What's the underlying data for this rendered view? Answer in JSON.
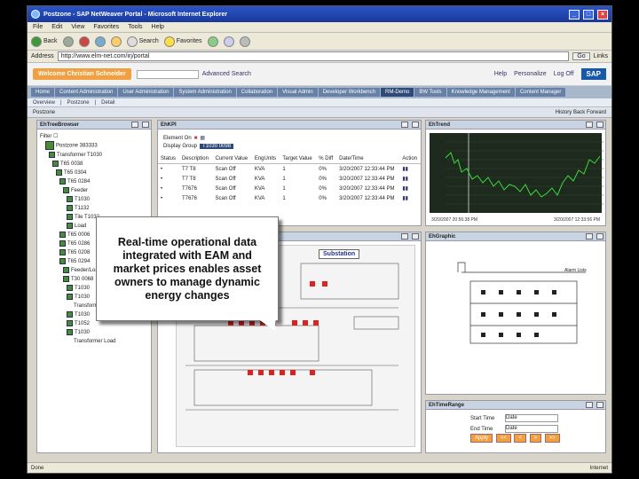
{
  "window": {
    "title": "Postzone - SAP NetWeaver Portal - Microsoft Internet Explorer"
  },
  "menu": [
    "File",
    "Edit",
    "View",
    "Favorites",
    "Tools",
    "Help"
  ],
  "toolbar": {
    "back": "Back",
    "search": "Search",
    "favorites": "Favorites"
  },
  "address": {
    "label": "Address",
    "value": "http://www.elm-net.com/irj/portal",
    "go": "Go",
    "links": "Links"
  },
  "portal": {
    "welcome": "Welcome Christian Schneider",
    "search_label": "Advanced Search",
    "links": [
      "Help",
      "Personalize",
      "Log Off"
    ],
    "logo": "SAP"
  },
  "tabs": [
    "Home",
    "Content Administration",
    "User Administration",
    "System Administration",
    "Collaboration",
    "Visual Admin",
    "Developer Workbench",
    "RM-Demo",
    "BW Tools",
    "Knowledge Management",
    "Content Manager"
  ],
  "subtabs": [
    "Overview",
    "Postzone",
    "Detail"
  ],
  "pagebar": {
    "title": "Postzone",
    "history": "History",
    "back": "Back",
    "forward": "Forward"
  },
  "panels": {
    "tree_title": "EhTreeBrowser",
    "table_title": "EhKPI",
    "trend_title": "EhTrend",
    "graphic_title": "EhGraphic",
    "range_title": "EhTimeRange"
  },
  "tree": {
    "filter": "Filter",
    "root": "Postzone 383333",
    "items": [
      "Transformer T1030",
      "T65 0038",
      "T65 0304",
      "T65 0284",
      "Feeder",
      "T1030",
      "T1132",
      "Tile T1032",
      "Load",
      "T65 0006",
      "T65 0286",
      "T65 0208",
      "T65 0294",
      "Feeder/Load",
      "T30 0068",
      "T1030",
      "T1030",
      "Transformer Load",
      "T1030",
      "T1052",
      "T1030",
      "Transformer Load"
    ]
  },
  "kpi": {
    "element_label": "Element On",
    "display_group_label": "Display Group",
    "display_group_value": "T1030 0098",
    "columns": [
      "Status",
      "Description",
      "Current Value",
      "EngUnits",
      "Target Value",
      "% Diff",
      "Date/Time",
      "Action"
    ],
    "rows": [
      [
        "•",
        "T7 T8",
        "Scan Off",
        "KVA",
        "1",
        "0%",
        "3/20/2007 12:33:44 PM",
        ""
      ],
      [
        "•",
        "T7 T8",
        "Scan Off",
        "KVA",
        "1",
        "0%",
        "3/20/2007 12:33:44 PM",
        ""
      ],
      [
        "•",
        "T7676",
        "Scan Off",
        "KVA",
        "1",
        "0%",
        "3/20/2007 12:33:44 PM",
        ""
      ],
      [
        "•",
        "T7676",
        "Scan Off",
        "KVA",
        "1",
        "0%",
        "3/20/2007 12:33:44 PM",
        ""
      ]
    ]
  },
  "trend": {
    "y_ticks": [
      "200",
      "190",
      "180",
      "170",
      "160",
      "150",
      "140",
      "130",
      "120",
      "110"
    ],
    "x_ticks": [
      "20",
      "18",
      "15",
      "15",
      "14 24 Hour(s)",
      "8",
      "6",
      "4",
      "2"
    ],
    "start": "3/20/2007 20:56:38 PM",
    "end": "3/20/2007 12:33:56 PM"
  },
  "schematic": {
    "label": "Substation"
  },
  "graphic_right": {
    "label": "Alarm Lists"
  },
  "range": {
    "start_label": "Start Time",
    "end_label": "End Time",
    "start_value": "Date",
    "end_value": "Date",
    "apply": "Apply",
    "prev": "<<",
    "back": "<",
    "fwd": ">",
    "next": ">>"
  },
  "callout": "Real-time operational data integrated with EAM and market prices enables asset owners to manage dynamic energy changes",
  "status": {
    "left": "Done",
    "right": "Internet"
  }
}
